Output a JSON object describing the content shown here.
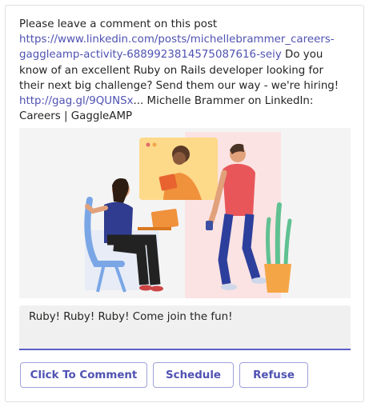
{
  "post": {
    "intro": "Please leave a comment on this post",
    "link1": "https://www.linkedin.com/posts/michellebrammer_careers-gaggleamp-activity-6889923814575087616-seiy",
    "body": " Do you know of an excellent Ruby on Rails developer looking for their next big challenge? Send them our way - we're hiring! ",
    "link2": "http://gag.gl/9QUNSx",
    "tail": "... Michelle Brammer on LinkedIn: Careers | GaggleAMP"
  },
  "reply": {
    "value": "Ruby! Ruby! Ruby!  Come join the fun!"
  },
  "actions": {
    "comment_label": "Click To Comment",
    "schedule_label": "Schedule",
    "refuse_label": "Refuse"
  },
  "colors": {
    "accent": "#5b5fc7",
    "link": "#4f52b2"
  }
}
